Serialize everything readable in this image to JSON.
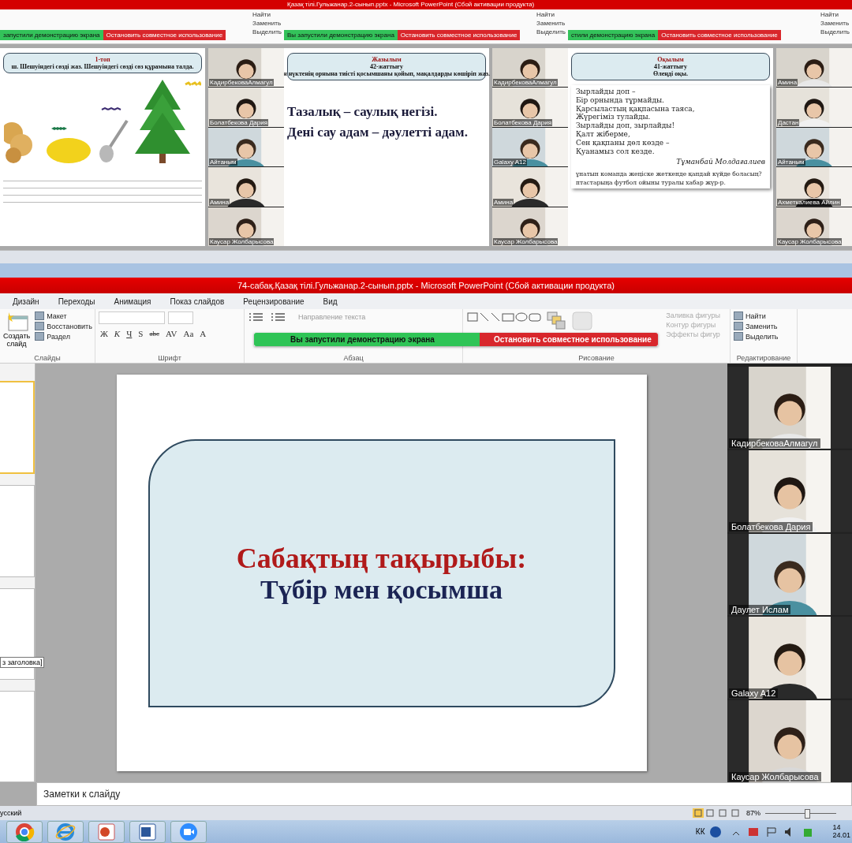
{
  "top_panels": [
    {
      "share_status": "запустили демонстрацию экрана",
      "stop_button": "Остановить совместное использование",
      "edit_items": [
        "Найти",
        "Заменить",
        "Выделить"
      ],
      "slide": {
        "kind": "pictures",
        "header": [
          "1-топ",
          "ш. Шешуіндегі сөзді жаз. Шешуіндегі сөзді сөз құрамына талда."
        ]
      },
      "participants": [
        "КадирбековаАлмагул",
        "Болатбекова Дария",
        "Айтаным",
        "Амина",
        "Каусар Жолбарысова"
      ]
    },
    {
      "title": "Қазақ тілі.Гульжанар.2-сынып.pptx - Microsoft PowerPoint (Сбой активации продукта)",
      "share_status": "Вы запустили демонстрацию экрана",
      "stop_button": "Остановить совместное использование",
      "edit_items": [
        "Найти",
        "Заменить",
        "Выделить"
      ],
      "slide": {
        "kind": "proverbs",
        "header": [
          "Жазылым",
          "42-жаттығу",
          "н нүктенің орнына тиісті қосымшаны қойып, мақалдарды көшіріп жаз."
        ],
        "lines": [
          "Тазалық – саулық негізі.",
          "Дені сау адам – дәулетті адам."
        ]
      },
      "participants": [
        "КадирбековаАлмагул",
        "Болатбекова Дария",
        "Galaxy A12",
        "Амина",
        "Каусар Жолбарысова"
      ]
    },
    {
      "share_status": "стили демонстрацию экрана",
      "stop_button": "Остановить совместное использование",
      "edit_items": [
        "Найти",
        "Заменить",
        "Выделить"
      ],
      "slide": {
        "kind": "poem",
        "header": [
          "Оқылым",
          "41-жаттығу",
          "Өлеңді оқы."
        ],
        "lines": [
          "Зырлайды доп –",
          "Бір орнында тұрмайды.",
          "Қарсыластың қақпасына таяса,",
          "Жүрегіміз тулайды.",
          "Зырлайды доп, зырлайды!",
          "Қалт жіберме,",
          "Сен қақпаны дөл көзде –",
          "Қуанамыз сол кезде."
        ],
        "author": "Тұманбай Молдағалиев",
        "questions": [
          "ұнатын команда жеңіске жеткенде қандай күйде боласың?",
          "птастарыңа футбол ойыны туралы хабар жүр-р."
        ]
      },
      "participants": [
        "Амина",
        "Дастан",
        "Айтаным",
        "Ахметкалиева Айлин",
        "Каусар Жолбарысова"
      ]
    }
  ],
  "window": {
    "title": "74-сабақ.Қазақ тілі.Гульжанар.2-сынып.pptx - Microsoft PowerPoint (Сбой активации продукта)"
  },
  "tabs": [
    {
      "label": "Дизайн",
      "selected": false
    },
    {
      "label": "Переходы",
      "selected": false
    },
    {
      "label": "Анимация",
      "selected": false
    },
    {
      "label": "Показ слайдов",
      "selected": false
    },
    {
      "label": "Рецензирование",
      "selected": false
    },
    {
      "label": "Вид",
      "selected": false
    }
  ],
  "ribbon": {
    "slides": {
      "new_slide": "Создать слайд",
      "items": [
        "Макет",
        "Восстановить",
        "Раздел"
      ],
      "label": "Слайды"
    },
    "font": {
      "buttons": [
        "Ж",
        "К",
        "Ч",
        "S",
        "abc",
        "AV",
        "Aa",
        "A"
      ],
      "label": "Шрифт"
    },
    "paragraph": {
      "items": [
        "Направление текста"
      ],
      "label": "Абзац"
    },
    "drawing": {
      "items": [
        "Заливка фигуры",
        "Контур фигуры",
        "Эффекты фигур"
      ],
      "label": "Рисование"
    },
    "editing": {
      "items": [
        "Найти",
        "Заменить",
        "Выделить"
      ],
      "label": "Редактирование"
    }
  },
  "share_bar": {
    "status": "Вы запустили демонстрацию экрана",
    "stop_button": "Остановить совместное использование"
  },
  "slide_panel": {
    "tooltip": "з заголовка]"
  },
  "slide": {
    "title": "Сабақтың тақырыбы:",
    "subtitle": "Түбір мен қосымша"
  },
  "participants": [
    "КадирбековаАлмагул",
    "Болатбекова Дария",
    "Даулет Ислам",
    "Galaxy A12",
    "Каусар Жолбарысова"
  ],
  "notes": {
    "placeholder": "Заметки к слайду"
  },
  "status_bar": {
    "language": "усский",
    "zoom": "87%",
    "zoom_slider": {
      "level": 0.55
    }
  },
  "taskbar": {
    "language": "КК",
    "time": "14",
    "date": "24.01"
  }
}
